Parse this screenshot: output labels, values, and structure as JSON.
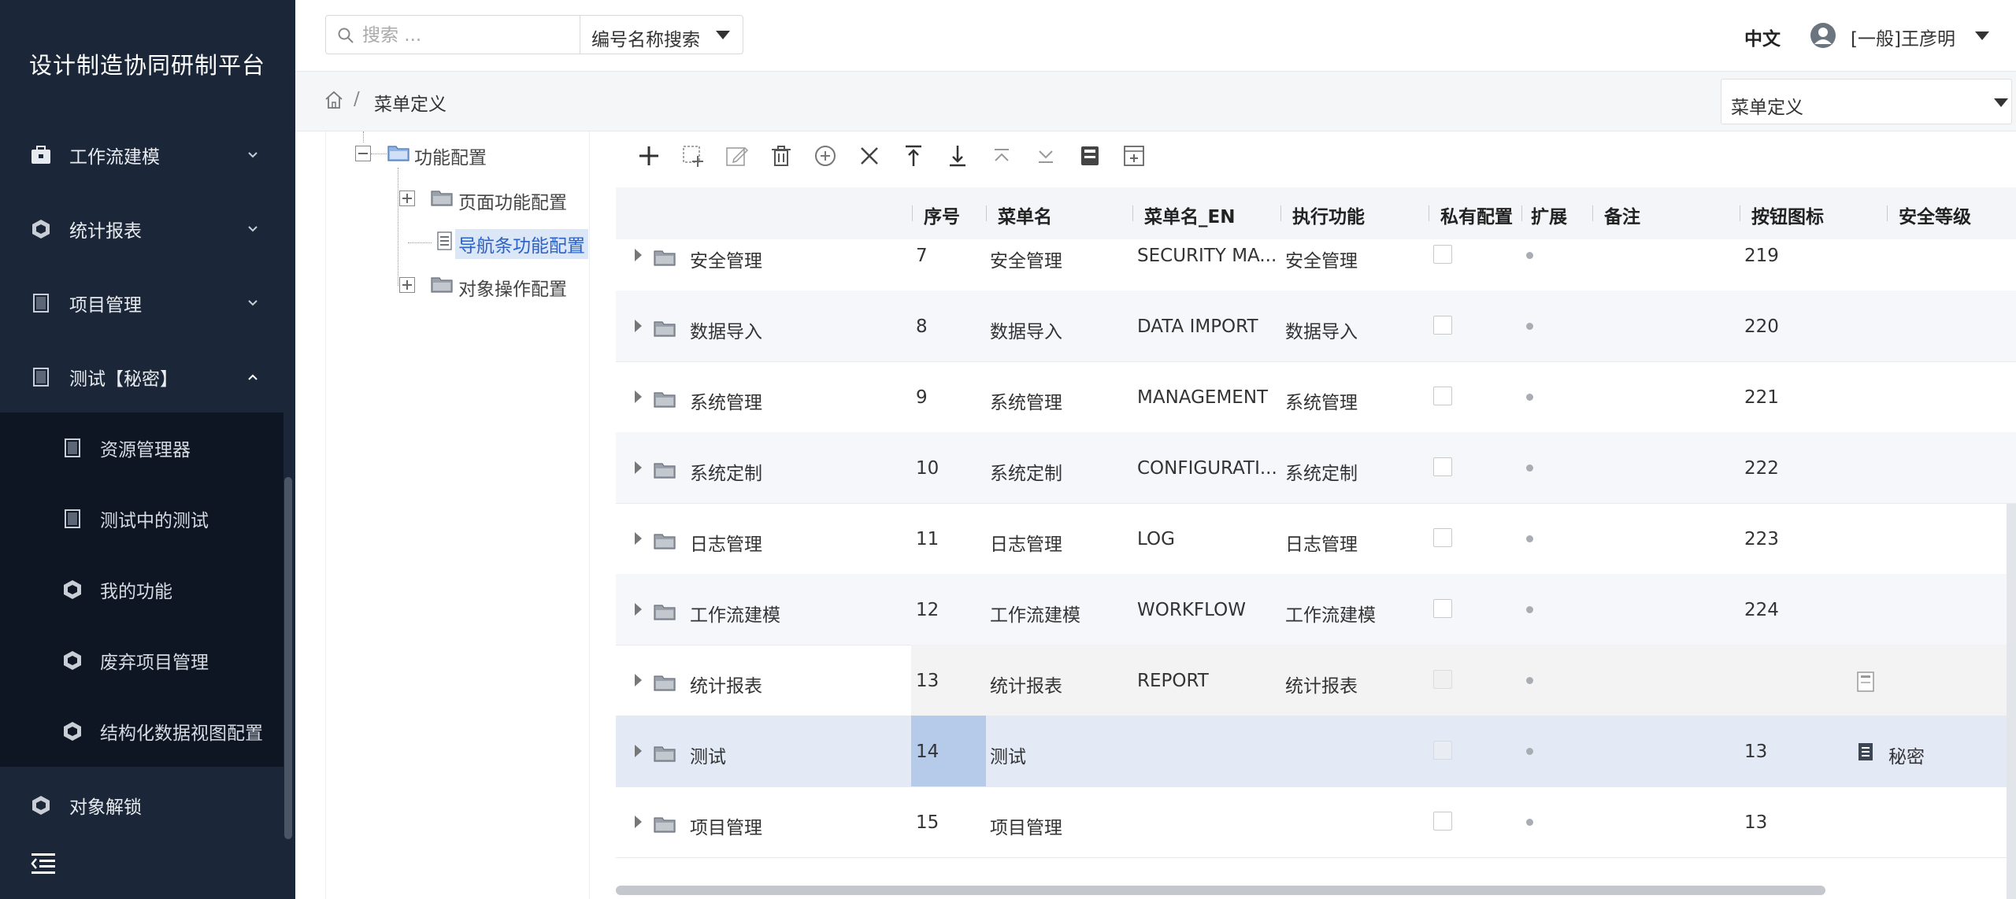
{
  "app": {
    "title": "设计制造协同研制平台"
  },
  "sidebar": {
    "items": [
      {
        "label": "工作流建模",
        "icon": "briefcase-icon"
      },
      {
        "label": "统计报表",
        "icon": "hexagon-icon"
      },
      {
        "label": "项目管理",
        "icon": "document-icon"
      },
      {
        "label": "测试【秘密】",
        "icon": "document-icon"
      }
    ],
    "subitems": [
      {
        "label": "资源管理器",
        "icon": "document-icon"
      },
      {
        "label": "测试中的测试",
        "icon": "document-icon"
      },
      {
        "label": "我的功能",
        "icon": "hexagon-icon"
      },
      {
        "label": "废弃项目管理",
        "icon": "hexagon-icon"
      },
      {
        "label": "结构化数据视图配置",
        "icon": "hexagon-icon"
      }
    ],
    "bottom_item": {
      "label": "对象解锁",
      "icon": "hexagon-icon"
    }
  },
  "header": {
    "search_placeholder": "搜索 ...",
    "search_mode": "编号名称搜索",
    "language": "中文",
    "user": "[一般]王彦明"
  },
  "breadcrumb": {
    "separator": "/",
    "current": "菜单定义",
    "select_value": "菜单定义"
  },
  "tree": {
    "root": "功能配置",
    "children": [
      "页面功能配置",
      "导航条功能配置",
      "对象操作配置"
    ]
  },
  "toolbar": {
    "icons": [
      "add-icon",
      "add-child-icon",
      "edit-icon",
      "delete-icon",
      "add-circle-icon",
      "close-icon",
      "move-up-icon",
      "move-down-icon",
      "move-top-icon",
      "move-bottom-icon",
      "save-icon",
      "expand-icon"
    ]
  },
  "grid": {
    "columns": [
      "序号",
      "菜单名",
      "菜单名_EN",
      "执行功能",
      "私有配置",
      "扩展",
      "备注",
      "按钮图标",
      "安全等级"
    ],
    "rows": [
      {
        "name": "安全管理",
        "seq": "7",
        "menu": "安全管理",
        "en": "SECURITY MA...",
        "func": "安全管理",
        "icon": "219",
        "security": ""
      },
      {
        "name": "数据导入",
        "seq": "8",
        "menu": "数据导入",
        "en": "DATA IMPORT",
        "func": "数据导入",
        "icon": "220",
        "security": ""
      },
      {
        "name": "系统管理",
        "seq": "9",
        "menu": "系统管理",
        "en": "MANAGEMENT",
        "func": "系统管理",
        "icon": "221",
        "security": ""
      },
      {
        "name": "系统定制",
        "seq": "10",
        "menu": "系统定制",
        "en": "CONFIGURATI...",
        "func": "系统定制",
        "icon": "222",
        "security": ""
      },
      {
        "name": "日志管理",
        "seq": "11",
        "menu": "日志管理",
        "en": "LOG",
        "func": "日志管理",
        "icon": "223",
        "security": ""
      },
      {
        "name": "工作流建模",
        "seq": "12",
        "menu": "工作流建模",
        "en": "WORKFLOW",
        "func": "工作流建模",
        "icon": "224",
        "security": ""
      },
      {
        "name": "统计报表",
        "seq": "13",
        "menu": "统计报表",
        "en": "REPORT",
        "func": "统计报表",
        "icon": "",
        "security": ""
      },
      {
        "name": "测试",
        "seq": "14",
        "menu": "测试",
        "en": "",
        "func": "",
        "icon": "13",
        "security": "秘密"
      },
      {
        "name": "项目管理",
        "seq": "15",
        "menu": "项目管理",
        "en": "",
        "func": "",
        "icon": "13",
        "security": ""
      }
    ]
  },
  "colors": {
    "sidebar": "#1b2738",
    "submenu": "#0d1622",
    "accent": "#2a62c9",
    "selected_row": "#e3eaf6"
  }
}
